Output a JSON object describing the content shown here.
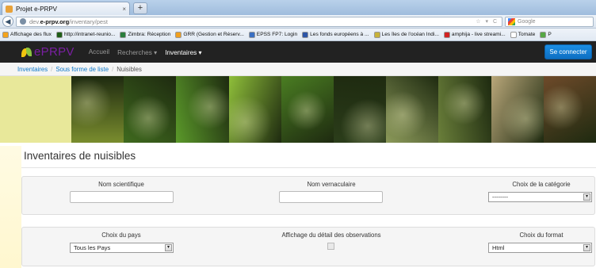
{
  "browser": {
    "tab_title": "Projet e-PRPV",
    "tab_close": "×",
    "new_tab": "+",
    "back": "◀",
    "url_prefix": "dev.",
    "url_host": "e-prpv.org",
    "url_path": "/inventary/pest",
    "url_icons": "☆ ▾ C",
    "search_placeholder": "Google",
    "bookmarks": [
      {
        "label": "Affichage des flux",
        "color": "#f4a31c"
      },
      {
        "label": "http://intranet-reunio...",
        "color": "#1f5e17"
      },
      {
        "label": "Zimbra: Réception",
        "color": "#2a7e3c"
      },
      {
        "label": "GRR (Gestion et Réserv...",
        "color": "#f0a020"
      },
      {
        "label": "EPSS FP7: Login",
        "color": "#3a6fc2"
      },
      {
        "label": "Les fonds européens à ...",
        "color": "#2e55a6"
      },
      {
        "label": "Les îles de l'océan Indi...",
        "color": "#c7b23a"
      },
      {
        "label": "amphija - live streami...",
        "color": "#d22222"
      },
      {
        "label": "Tomate",
        "color": "#ffffff"
      },
      {
        "label": "P",
        "color": "#55a844"
      }
    ]
  },
  "site": {
    "logo": "ePRPV",
    "nav": [
      {
        "label": "Accueil"
      },
      {
        "label": "Recherches ▾"
      },
      {
        "label": "Inventaires ▾"
      }
    ],
    "connect_label": "Se connecter"
  },
  "breadcrumb": {
    "items": [
      "Inventaires",
      "Sous forme de liste"
    ],
    "separator": "/",
    "current": "Nuisibles"
  },
  "banner": {
    "photos": [
      "#7a8d2e",
      "#3f6a1e",
      "#5b9a2a",
      "#8fbf3a",
      "#4a7d22",
      "#2b3d1a",
      "#8c9a5a",
      "#6a7f3a",
      "#b9a77a",
      "#6e4a2a"
    ]
  },
  "page": {
    "title": "Inventaires de nuisibles"
  },
  "filters": {
    "nom_scientifique_label": "Nom scientifique",
    "nom_scientifique_value": "",
    "nom_vernaculaire_label": "Nom vernaculaire",
    "nom_vernaculaire_value": "",
    "categorie_label": "Choix de la catégorie",
    "categorie_value": "--------",
    "pays_label": "Choix du pays",
    "pays_value": "Tous les Pays",
    "detail_label": "Affichage du détail des observations",
    "format_label": "Choix du format",
    "format_value": "Html",
    "select_arrow": "▾"
  }
}
